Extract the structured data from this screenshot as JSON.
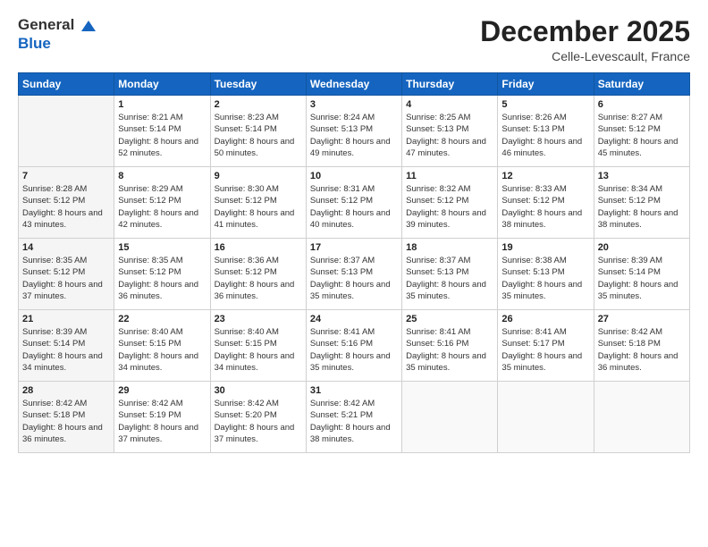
{
  "header": {
    "logo_line1": "General",
    "logo_line2": "Blue",
    "month_title": "December 2025",
    "subtitle": "Celle-Levescault, France"
  },
  "weekdays": [
    "Sunday",
    "Monday",
    "Tuesday",
    "Wednesday",
    "Thursday",
    "Friday",
    "Saturday"
  ],
  "weeks": [
    [
      {
        "day": "",
        "sunrise": "",
        "sunset": "",
        "daylight": ""
      },
      {
        "day": "1",
        "sunrise": "Sunrise: 8:21 AM",
        "sunset": "Sunset: 5:14 PM",
        "daylight": "Daylight: 8 hours and 52 minutes."
      },
      {
        "day": "2",
        "sunrise": "Sunrise: 8:23 AM",
        "sunset": "Sunset: 5:14 PM",
        "daylight": "Daylight: 8 hours and 50 minutes."
      },
      {
        "day": "3",
        "sunrise": "Sunrise: 8:24 AM",
        "sunset": "Sunset: 5:13 PM",
        "daylight": "Daylight: 8 hours and 49 minutes."
      },
      {
        "day": "4",
        "sunrise": "Sunrise: 8:25 AM",
        "sunset": "Sunset: 5:13 PM",
        "daylight": "Daylight: 8 hours and 47 minutes."
      },
      {
        "day": "5",
        "sunrise": "Sunrise: 8:26 AM",
        "sunset": "Sunset: 5:13 PM",
        "daylight": "Daylight: 8 hours and 46 minutes."
      },
      {
        "day": "6",
        "sunrise": "Sunrise: 8:27 AM",
        "sunset": "Sunset: 5:12 PM",
        "daylight": "Daylight: 8 hours and 45 minutes."
      }
    ],
    [
      {
        "day": "7",
        "sunrise": "Sunrise: 8:28 AM",
        "sunset": "Sunset: 5:12 PM",
        "daylight": "Daylight: 8 hours and 43 minutes."
      },
      {
        "day": "8",
        "sunrise": "Sunrise: 8:29 AM",
        "sunset": "Sunset: 5:12 PM",
        "daylight": "Daylight: 8 hours and 42 minutes."
      },
      {
        "day": "9",
        "sunrise": "Sunrise: 8:30 AM",
        "sunset": "Sunset: 5:12 PM",
        "daylight": "Daylight: 8 hours and 41 minutes."
      },
      {
        "day": "10",
        "sunrise": "Sunrise: 8:31 AM",
        "sunset": "Sunset: 5:12 PM",
        "daylight": "Daylight: 8 hours and 40 minutes."
      },
      {
        "day": "11",
        "sunrise": "Sunrise: 8:32 AM",
        "sunset": "Sunset: 5:12 PM",
        "daylight": "Daylight: 8 hours and 39 minutes."
      },
      {
        "day": "12",
        "sunrise": "Sunrise: 8:33 AM",
        "sunset": "Sunset: 5:12 PM",
        "daylight": "Daylight: 8 hours and 38 minutes."
      },
      {
        "day": "13",
        "sunrise": "Sunrise: 8:34 AM",
        "sunset": "Sunset: 5:12 PM",
        "daylight": "Daylight: 8 hours and 38 minutes."
      }
    ],
    [
      {
        "day": "14",
        "sunrise": "Sunrise: 8:35 AM",
        "sunset": "Sunset: 5:12 PM",
        "daylight": "Daylight: 8 hours and 37 minutes."
      },
      {
        "day": "15",
        "sunrise": "Sunrise: 8:35 AM",
        "sunset": "Sunset: 5:12 PM",
        "daylight": "Daylight: 8 hours and 36 minutes."
      },
      {
        "day": "16",
        "sunrise": "Sunrise: 8:36 AM",
        "sunset": "Sunset: 5:12 PM",
        "daylight": "Daylight: 8 hours and 36 minutes."
      },
      {
        "day": "17",
        "sunrise": "Sunrise: 8:37 AM",
        "sunset": "Sunset: 5:13 PM",
        "daylight": "Daylight: 8 hours and 35 minutes."
      },
      {
        "day": "18",
        "sunrise": "Sunrise: 8:37 AM",
        "sunset": "Sunset: 5:13 PM",
        "daylight": "Daylight: 8 hours and 35 minutes."
      },
      {
        "day": "19",
        "sunrise": "Sunrise: 8:38 AM",
        "sunset": "Sunset: 5:13 PM",
        "daylight": "Daylight: 8 hours and 35 minutes."
      },
      {
        "day": "20",
        "sunrise": "Sunrise: 8:39 AM",
        "sunset": "Sunset: 5:14 PM",
        "daylight": "Daylight: 8 hours and 35 minutes."
      }
    ],
    [
      {
        "day": "21",
        "sunrise": "Sunrise: 8:39 AM",
        "sunset": "Sunset: 5:14 PM",
        "daylight": "Daylight: 8 hours and 34 minutes."
      },
      {
        "day": "22",
        "sunrise": "Sunrise: 8:40 AM",
        "sunset": "Sunset: 5:15 PM",
        "daylight": "Daylight: 8 hours and 34 minutes."
      },
      {
        "day": "23",
        "sunrise": "Sunrise: 8:40 AM",
        "sunset": "Sunset: 5:15 PM",
        "daylight": "Daylight: 8 hours and 34 minutes."
      },
      {
        "day": "24",
        "sunrise": "Sunrise: 8:41 AM",
        "sunset": "Sunset: 5:16 PM",
        "daylight": "Daylight: 8 hours and 35 minutes."
      },
      {
        "day": "25",
        "sunrise": "Sunrise: 8:41 AM",
        "sunset": "Sunset: 5:16 PM",
        "daylight": "Daylight: 8 hours and 35 minutes."
      },
      {
        "day": "26",
        "sunrise": "Sunrise: 8:41 AM",
        "sunset": "Sunset: 5:17 PM",
        "daylight": "Daylight: 8 hours and 35 minutes."
      },
      {
        "day": "27",
        "sunrise": "Sunrise: 8:42 AM",
        "sunset": "Sunset: 5:18 PM",
        "daylight": "Daylight: 8 hours and 36 minutes."
      }
    ],
    [
      {
        "day": "28",
        "sunrise": "Sunrise: 8:42 AM",
        "sunset": "Sunset: 5:18 PM",
        "daylight": "Daylight: 8 hours and 36 minutes."
      },
      {
        "day": "29",
        "sunrise": "Sunrise: 8:42 AM",
        "sunset": "Sunset: 5:19 PM",
        "daylight": "Daylight: 8 hours and 37 minutes."
      },
      {
        "day": "30",
        "sunrise": "Sunrise: 8:42 AM",
        "sunset": "Sunset: 5:20 PM",
        "daylight": "Daylight: 8 hours and 37 minutes."
      },
      {
        "day": "31",
        "sunrise": "Sunrise: 8:42 AM",
        "sunset": "Sunset: 5:21 PM",
        "daylight": "Daylight: 8 hours and 38 minutes."
      },
      {
        "day": "",
        "sunrise": "",
        "sunset": "",
        "daylight": ""
      },
      {
        "day": "",
        "sunrise": "",
        "sunset": "",
        "daylight": ""
      },
      {
        "day": "",
        "sunrise": "",
        "sunset": "",
        "daylight": ""
      }
    ]
  ]
}
